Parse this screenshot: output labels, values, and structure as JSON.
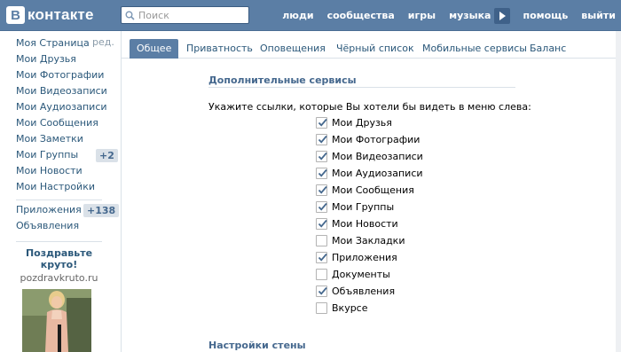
{
  "header": {
    "logo_letter": "В",
    "logo_text": "контакте",
    "search_placeholder": "Поиск",
    "nav": [
      "люди",
      "сообщества",
      "игры",
      "музыка"
    ],
    "nav_after": [
      "помощь",
      "выйти"
    ]
  },
  "leftmenu": {
    "edit_label": "ред.",
    "items": [
      "Моя Страница",
      "Мои Друзья",
      "Мои Фотографии",
      "Мои Видеозаписи",
      "Мои Аудиозаписи",
      "Мои Сообщения",
      "Мои Заметки",
      "Мои Группы",
      "Мои Новости",
      "Мои Настройки"
    ],
    "groups_badge": "+2",
    "apps_label": "Приложения",
    "apps_badge": "+138",
    "ads_label": "Объявления",
    "promo_title": "Поздравьте круто!",
    "promo_url": "pozdravkruto.ru"
  },
  "tabs": [
    "Общее",
    "Приватность",
    "Оповещения",
    "Чёрный список",
    "Мобильные сервисы",
    "Баланс"
  ],
  "section": {
    "title": "Дополнительные сервисы",
    "hint": "Укажите ссылки, которые Вы хотели бы видеть в меню слева:",
    "options": [
      {
        "label": "Мои Друзья",
        "checked": true
      },
      {
        "label": "Мои Фотографии",
        "checked": true
      },
      {
        "label": "Мои Видеозаписи",
        "checked": true
      },
      {
        "label": "Мои Аудиозаписи",
        "checked": true
      },
      {
        "label": "Мои Сообщения",
        "checked": true
      },
      {
        "label": "Мои Группы",
        "checked": true
      },
      {
        "label": "Мои Новости",
        "checked": true
      },
      {
        "label": "Мои Закладки",
        "checked": false
      },
      {
        "label": "Приложения",
        "checked": true
      },
      {
        "label": "Документы",
        "checked": false
      },
      {
        "label": "Объявления",
        "checked": true
      },
      {
        "label": "Вкурсе",
        "checked": false
      }
    ]
  },
  "wall_section": {
    "title": "Настройки стены"
  },
  "colors": {
    "header": "#5b7ea5",
    "link": "#2b587a",
    "section_title": "#45688e",
    "active_tab": "#5b7ea5"
  }
}
